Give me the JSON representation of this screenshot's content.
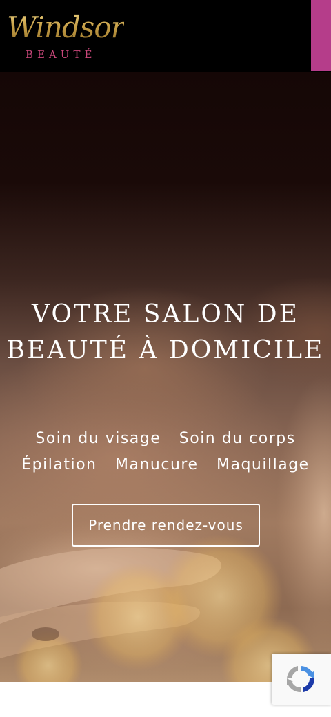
{
  "header": {
    "logo_script": "Windsor",
    "logo_sub": "BEAUTÉ",
    "menu_icon": "menu-tab-icon",
    "accent_color": "#b53d8a"
  },
  "hero": {
    "title_line1": "VOTRE SALON DE",
    "title_line2": "BEAUTÉ À DOMICILE",
    "services_row1": [
      "Soin du visage",
      "Soin du corps"
    ],
    "services_row2": [
      "Épilation",
      "Manucure",
      "Maquillage"
    ],
    "cta_label": "Prendre rendez-vous"
  },
  "recaptcha": {
    "icon": "recaptcha-icon"
  }
}
